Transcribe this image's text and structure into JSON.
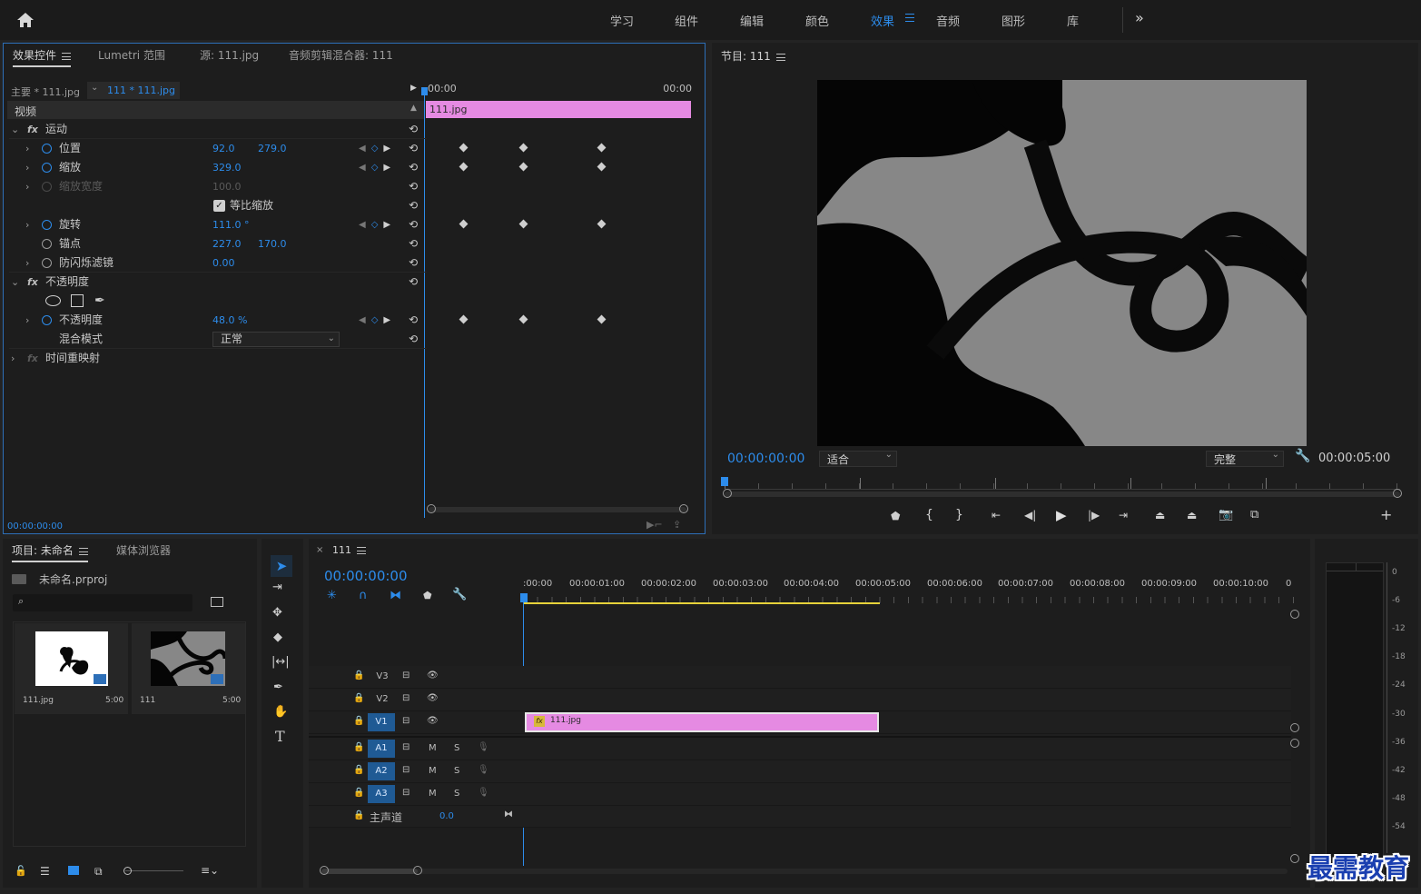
{
  "workspace": {
    "tabs": [
      "学习",
      "组件",
      "编辑",
      "颜色",
      "效果",
      "音频",
      "图形",
      "库"
    ],
    "active_tab": "效果",
    "more": "»"
  },
  "effect_controls": {
    "tabs": [
      "效果控件",
      "Lumetri 范围",
      "源: 111.jpg",
      "音频剪辑混合器: 111"
    ],
    "master": "主要 * 111.jpg",
    "clip": "111 * 111.jpg",
    "section_video": "视频",
    "ruler_start": "00:00",
    "ruler_end": "00:00",
    "clip_bar": "111.jpg",
    "timecode": "00:00:00:00",
    "motion": "运动",
    "position": {
      "label": "位置",
      "x": "92.0",
      "y": "279.0"
    },
    "scale": {
      "label": "缩放",
      "value": "329.0"
    },
    "scale_width": {
      "label": "缩放宽度",
      "value": "100.0"
    },
    "uniform_scale": "等比缩放",
    "rotation": {
      "label": "旋转",
      "value": "111.0 °"
    },
    "anchor": {
      "label": "锚点",
      "x": "227.0",
      "y": "170.0"
    },
    "anti_flicker": {
      "label": "防闪烁滤镜",
      "value": "0.00"
    },
    "opacity_fx": "不透明度",
    "opacity": {
      "label": "不透明度",
      "value": "48.0 %"
    },
    "blend_mode": {
      "label": "混合模式",
      "value": "正常"
    },
    "time_remap": "时间重映射"
  },
  "program": {
    "title": "节目: 111",
    "timecode": "00:00:00:00",
    "fit": "适合",
    "quality": "完整",
    "duration": "00:00:05:00"
  },
  "project": {
    "tabs": [
      "项目: 未命名",
      "媒体浏览器"
    ],
    "file": "未命名.prproj",
    "items": [
      {
        "name": "111.jpg",
        "duration": "5:00"
      },
      {
        "name": "111",
        "duration": "5:00"
      }
    ]
  },
  "timeline": {
    "seq_tab": "111",
    "timecode": "00:00:00:00",
    "ruler": [
      ":00:00",
      "00:00:01:00",
      "00:00:02:00",
      "00:00:03:00",
      "00:00:04:00",
      "00:00:05:00",
      "00:00:06:00",
      "00:00:07:00",
      "00:00:08:00",
      "00:00:09:00",
      "00:00:10:00",
      "0"
    ],
    "video_tracks": [
      "V3",
      "V2",
      "V1"
    ],
    "audio_tracks": [
      "A1",
      "A2",
      "A3"
    ],
    "master": "主声道",
    "master_value": "0.0",
    "clip": "111.jpg",
    "fx": "fx",
    "m": "M",
    "s": "S"
  },
  "meter": {
    "labels": [
      "0",
      "-6",
      "-12",
      "-18",
      "-24",
      "-30",
      "-36",
      "-42",
      "-48",
      "-54"
    ]
  },
  "watermark": "最需教育",
  "colors": {
    "accent": "#2d8ceb",
    "clip_pink": "#e58ae2",
    "panel": "#1d1d1d",
    "bg": "#232323",
    "track_blue": "#1f5a94"
  }
}
